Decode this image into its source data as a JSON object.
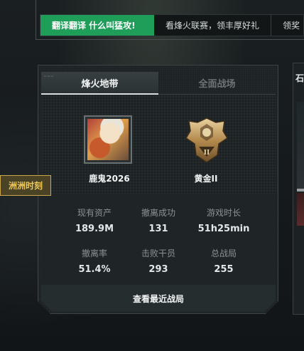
{
  "ticker": {
    "items": [
      {
        "label": "翻译翻译 什么叫猛攻!",
        "active": true
      },
      {
        "label": "看烽火联赛，领丰厚好礼",
        "active": false
      },
      {
        "label": "领奖",
        "active": false
      }
    ]
  },
  "side_tag": {
    "label": "洲洲时刻"
  },
  "card": {
    "tabs": [
      {
        "label": "烽火地带",
        "active": true
      },
      {
        "label": "全面战场",
        "active": false
      }
    ],
    "player": {
      "name": "鹿鬼2026",
      "rank": "黄金II"
    },
    "stats": [
      {
        "label": "现有资产",
        "value": "189.9M"
      },
      {
        "label": "撤离成功",
        "value": "131"
      },
      {
        "label": "游戏时长",
        "value": "51h25min"
      },
      {
        "label": "撤离率",
        "value": "51.4%"
      },
      {
        "label": "击败干员",
        "value": "293"
      },
      {
        "label": "总战局",
        "value": "255"
      }
    ],
    "footer_button": {
      "label": "查看最近战局"
    }
  },
  "colors": {
    "accent_green": "#1f9e5a",
    "tag_gold": "#f0c85a",
    "background": "#15191b"
  }
}
